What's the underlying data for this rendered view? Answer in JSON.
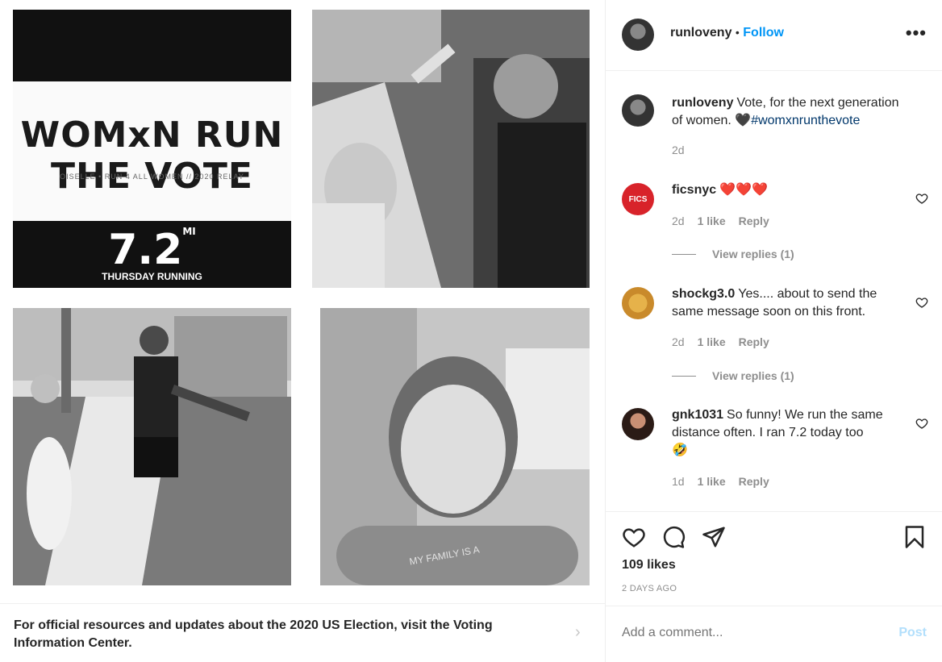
{
  "media": {
    "tile1": {
      "logo_line": "WOMxN RUN THE VOTE",
      "logo_sub": "OISELLE • RUN 4 ALL WOMEN // 2020 RELAY",
      "miles": "7.2",
      "miles_unit": "MI",
      "miles_sub": "THURSDAY RUNNING"
    },
    "tile4_shirt_text": "MY FAMILY IS A"
  },
  "vote_banner": {
    "text": "For official resources and updates about the 2020 US Election, visit the Voting Information Center.",
    "arrow": "›"
  },
  "header": {
    "username": "runloveny",
    "separator": "•",
    "follow_label": "Follow",
    "more_label": "•••"
  },
  "caption": {
    "username": "runloveny",
    "text": "Vote, for the next generation of women. 🖤",
    "hashtag": "#womxnrunthevote",
    "time": "2d"
  },
  "comments": [
    {
      "username": "ficsnyc",
      "avatar_text": "FICS",
      "text": "❤️❤️❤️",
      "time": "2d",
      "likes": "1 like",
      "reply": "Reply",
      "view_replies": "View replies (1)"
    },
    {
      "username": "shockg3.0",
      "text": "Yes.... about to send the same message soon on this front.",
      "time": "2d",
      "likes": "1 like",
      "reply": "Reply",
      "view_replies": "View replies (1)"
    },
    {
      "username": "gnk1031",
      "text": "So funny! We run the same distance often. I ran 7.2 today too",
      "emoji": "🤣",
      "time": "1d",
      "likes": "1 like",
      "reply": "Reply"
    }
  ],
  "actions": {
    "likes": "109 likes",
    "ago": "2 DAYS AGO"
  },
  "add_comment": {
    "placeholder": "Add a comment...",
    "post_label": "Post"
  },
  "colors": {
    "accent": "#0095f6",
    "hashtag": "#00376b",
    "muted": "#8e8e8e",
    "heart": "#ed4956"
  },
  "icons": [
    "heart-icon",
    "comment-icon",
    "share-icon",
    "bookmark-icon",
    "more-icon",
    "chevron-right-icon"
  ]
}
